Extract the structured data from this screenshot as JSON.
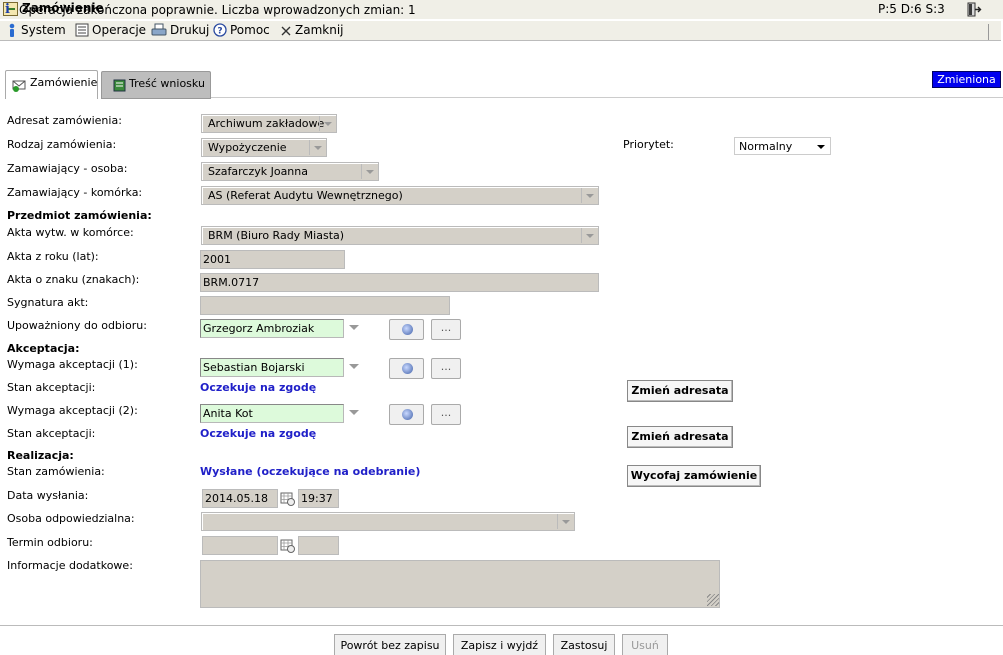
{
  "window": {
    "title": "Zamówienie",
    "stats": "P:5 D:6 S:3"
  },
  "menu": {
    "system": "System",
    "operacje": "Operacje",
    "drukuj": "Drukuj",
    "pomoc": "Pomoc",
    "zamknij": "Zamknij"
  },
  "info": {
    "message": "Operacja zakończona poprawnie. Liczba wprowadzonych zmian: 1"
  },
  "tabs": {
    "zamowienie": "Zamówienie",
    "tresc": "Treść wniosku"
  },
  "status_badge": "Zmieniona",
  "labels": {
    "adresat": "Adresat zamówienia:",
    "rodzaj": "Rodzaj zamówienia:",
    "osoba": "Zamawiający - osoba:",
    "komorka": "Zamawiający - komórka:",
    "przedmiot": "Przedmiot zamówienia:",
    "akta_komorka": "Akta wytw. w komórce:",
    "akta_rok": "Akta z roku (lat):",
    "akta_znak": "Akta o znaku (znakach):",
    "sygnatura": "Sygnatura akt:",
    "upowazniony": "Upoważniony do odbioru:",
    "akceptacja": "Akceptacja:",
    "akc1": "Wymaga akceptacji (1):",
    "stan1": "Stan akceptacji:",
    "akc2": "Wymaga akceptacji (2):",
    "stan2": "Stan akceptacji:",
    "realizacja": "Realizacja:",
    "stan_zam": "Stan zamówienia:",
    "data_wys": "Data wysłania:",
    "osoba_odp": "Osoba odpowiedzialna:",
    "termin": "Termin odbioru:",
    "info_dod": "Informacje dodatkowe:",
    "priorytet": "Priorytet:"
  },
  "values": {
    "adresat": "Archiwum zakładowe",
    "rodzaj": "Wypożyczenie",
    "osoba": "Szafarczyk Joanna",
    "komorka": "AS (Referat Audytu Wewnętrznego)",
    "akta_komorka": "BRM (Biuro Rady Miasta)",
    "akta_rok": "2001",
    "akta_znak": "BRM.0717",
    "sygnatura": "",
    "upowazniony": "Grzegorz Ambroziak",
    "akc1": "Sebastian Bojarski",
    "stan1": "Oczekuje na zgodę",
    "akc2": "Anita Kot",
    "stan2": "Oczekuje na zgodę",
    "stan_zam": "Wysłane (oczekujące na odebranie)",
    "data_wys": "2014.05.18",
    "czas_wys": "19:37",
    "osoba_odp": "",
    "termin_data": "",
    "termin_czas": "",
    "info_dod": "",
    "priorytet": "Normalny"
  },
  "buttons": {
    "dots": "...",
    "zmien1": "Zmień adresata",
    "zmien2": "Zmień adresata",
    "wycofaj": "Wycofaj zamówienie",
    "powrot": "Powrót bez zapisu",
    "zapisz": "Zapisz i wyjdź",
    "zastosuj": "Zastosuj",
    "usun": "Usuń"
  }
}
